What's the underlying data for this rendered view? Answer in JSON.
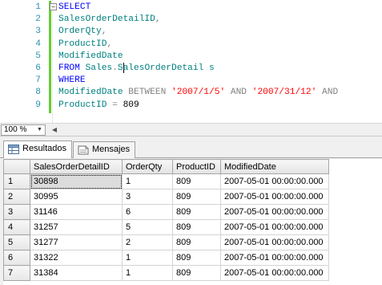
{
  "editor": {
    "lines": [
      {
        "num": "1",
        "parts": [
          {
            "t": "SELECT",
            "c": "kw"
          }
        ]
      },
      {
        "num": "2",
        "parts": [
          {
            "t": "SalesOrderDetailID",
            "c": "id"
          },
          {
            "t": ",",
            "c": "gray"
          }
        ]
      },
      {
        "num": "3",
        "parts": [
          {
            "t": "OrderQty",
            "c": "id"
          },
          {
            "t": ",",
            "c": "gray"
          }
        ]
      },
      {
        "num": "4",
        "parts": [
          {
            "t": "ProductID",
            "c": "id"
          },
          {
            "t": ",",
            "c": "gray"
          }
        ]
      },
      {
        "num": "5",
        "parts": [
          {
            "t": "ModifiedDate",
            "c": "id"
          }
        ]
      },
      {
        "num": "6",
        "parts": [
          {
            "t": "FROM ",
            "c": "kw"
          },
          {
            "t": "Sales",
            "c": "id"
          },
          {
            "t": ".",
            "c": "gray"
          },
          {
            "t": "S",
            "c": "id"
          },
          {
            "t": "|",
            "c": "cursor"
          },
          {
            "t": "alesOrderDetail",
            "c": "id"
          },
          {
            "t": " s",
            "c": "id"
          }
        ]
      },
      {
        "num": "7",
        "parts": [
          {
            "t": "WHERE",
            "c": "kw"
          }
        ]
      },
      {
        "num": "8",
        "parts": [
          {
            "t": "ModifiedDate",
            "c": "id"
          },
          {
            "t": " BETWEEN ",
            "c": "gray"
          },
          {
            "t": "'2007/1/5'",
            "c": "str"
          },
          {
            "t": " AND ",
            "c": "gray"
          },
          {
            "t": "'2007/31/12'",
            "c": "str"
          },
          {
            "t": " AND",
            "c": "gray"
          }
        ]
      },
      {
        "num": "9",
        "parts": [
          {
            "t": "ProductID",
            "c": "id"
          },
          {
            "t": " = ",
            "c": "gray"
          },
          {
            "t": "809",
            "c": "blk"
          }
        ]
      }
    ],
    "collapse_symbol": "−"
  },
  "zoom": {
    "value": "100 %"
  },
  "tabs": [
    {
      "label": "Resultados",
      "icon": "grid-icon",
      "active": true
    },
    {
      "label": "Mensajes",
      "icon": "messages-icon",
      "active": false
    }
  ],
  "grid": {
    "columns": [
      "SalesOrderDetailID",
      "OrderQty",
      "ProductID",
      "ModifiedDate"
    ],
    "rows": [
      {
        "n": "1",
        "cells": [
          "30898",
          "1",
          "809",
          "2007-05-01 00:00:00.000"
        ]
      },
      {
        "n": "2",
        "cells": [
          "30995",
          "3",
          "809",
          "2007-05-01 00:00:00.000"
        ]
      },
      {
        "n": "3",
        "cells": [
          "31146",
          "6",
          "809",
          "2007-05-01 00:00:00.000"
        ]
      },
      {
        "n": "4",
        "cells": [
          "31257",
          "5",
          "809",
          "2007-05-01 00:00:00.000"
        ]
      },
      {
        "n": "5",
        "cells": [
          "31277",
          "2",
          "809",
          "2007-05-01 00:00:00.000"
        ]
      },
      {
        "n": "6",
        "cells": [
          "31322",
          "1",
          "809",
          "2007-05-01 00:00:00.000"
        ]
      },
      {
        "n": "7",
        "cells": [
          "31384",
          "1",
          "809",
          "2007-05-01 00:00:00.000"
        ]
      }
    ]
  },
  "colors": {
    "keyword": "#0000ff",
    "identifier": "#008080",
    "string": "#ff0000",
    "operator": "#808080",
    "line_number": "#2b91af",
    "change_bar": "#66cc33"
  }
}
